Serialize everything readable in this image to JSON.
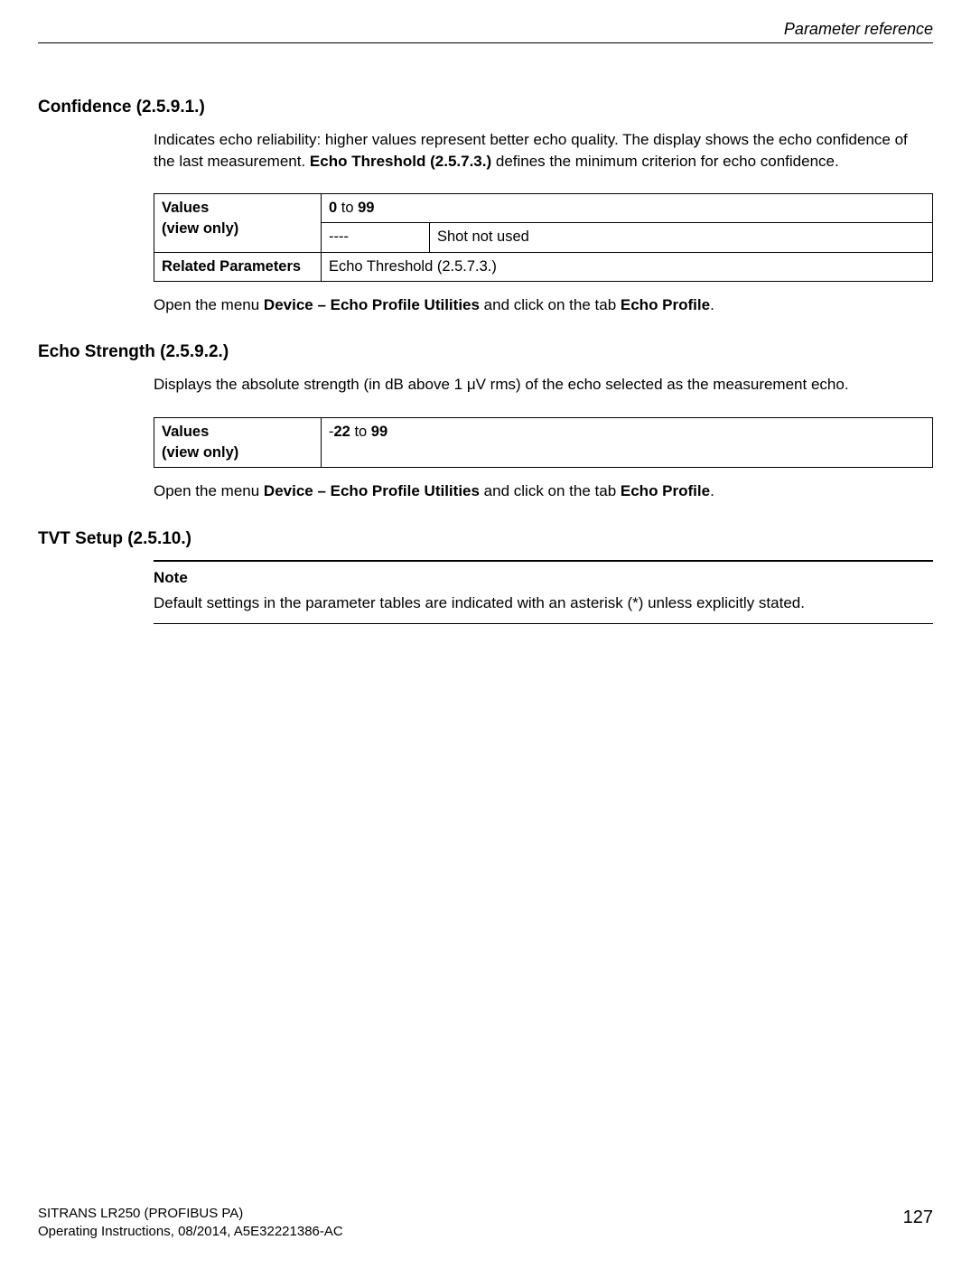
{
  "header": {
    "section": "Parameter reference"
  },
  "s1": {
    "heading": "Confidence (2.5.9.1.)",
    "desc_pre": "Indicates echo reliability: higher values represent better echo quality. The display shows the echo confidence of the last measurement. ",
    "desc_bold": "Echo Threshold (2.5.7.3.)",
    "desc_post": " defines the minimum criterion for echo confidence.",
    "row1_label_l1": "Values",
    "row1_label_l2": "(view only)",
    "row1_val_b1": "0",
    "row1_val_mid": " to ",
    "row1_val_b2": "99",
    "row2_c1": "----",
    "row2_c2": "Shot not used",
    "row3_label": "Related Parameters",
    "row3_val": "Echo Threshold (2.5.7.3.)",
    "instr_pre": "Open the menu ",
    "instr_b1": "Device – Echo Profile Utilities",
    "instr_mid": " and click on the tab ",
    "instr_b2": "Echo Profile",
    "instr_post": "."
  },
  "s2": {
    "heading": "Echo Strength (2.5.9.2.)",
    "desc": "Displays the absolute strength (in dB above 1 μV rms) of the echo selected as the measurement echo.",
    "row1_label_l1": "Values",
    "row1_label_l2": "(view only)",
    "row1_val_pre": "-",
    "row1_val_b1": "22",
    "row1_val_mid": " to ",
    "row1_val_b2": "99",
    "instr_pre": "Open the menu ",
    "instr_b1": "Device – Echo Profile Utilities",
    "instr_mid": " and click on the tab ",
    "instr_b2": "Echo Profile",
    "instr_post": "."
  },
  "s3": {
    "heading": "TVT Setup (2.5.10.)",
    "note_title": "Note",
    "note_body": "Default settings in the parameter tables are indicated with an asterisk (*) unless explicitly stated."
  },
  "footer": {
    "line1": "SITRANS LR250 (PROFIBUS PA)",
    "line2": "Operating Instructions, 08/2014, A5E32221386-AC",
    "page": "127"
  }
}
